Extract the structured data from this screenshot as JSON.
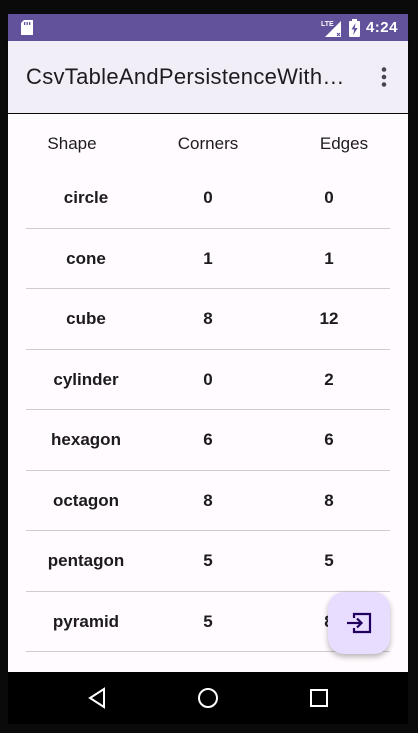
{
  "status_bar": {
    "network": "LTE",
    "time": "4:24"
  },
  "app_bar": {
    "title": "CsvTableAndPersistenceWith…",
    "overflow_icon": "more-vert-icon"
  },
  "table": {
    "headers": [
      "Shape",
      "Corners",
      "Edges"
    ],
    "rows": [
      {
        "shape": "circle",
        "corners": "0",
        "edges": "0"
      },
      {
        "shape": "cone",
        "corners": "1",
        "edges": "1"
      },
      {
        "shape": "cube",
        "corners": "8",
        "edges": "12"
      },
      {
        "shape": "cylinder",
        "corners": "0",
        "edges": "2"
      },
      {
        "shape": "hexagon",
        "corners": "6",
        "edges": "6"
      },
      {
        "shape": "octagon",
        "corners": "8",
        "edges": "8"
      },
      {
        "shape": "pentagon",
        "corners": "5",
        "edges": "5"
      },
      {
        "shape": "pyramid",
        "corners": "5",
        "edges": "8"
      },
      {
        "shape": "",
        "corners": "",
        "edges": ""
      }
    ]
  },
  "fab": {
    "icon": "input-arrow-icon"
  },
  "nav_bar": {
    "back_icon": "back-triangle-icon",
    "home_icon": "home-circle-icon",
    "recents_icon": "recents-square-icon"
  },
  "colors": {
    "status_bar": "#62529c",
    "app_bar": "#f2eef8",
    "content_bg": "#fffbfe",
    "fab_bg": "#e9ddff",
    "accent": "#21005d"
  }
}
